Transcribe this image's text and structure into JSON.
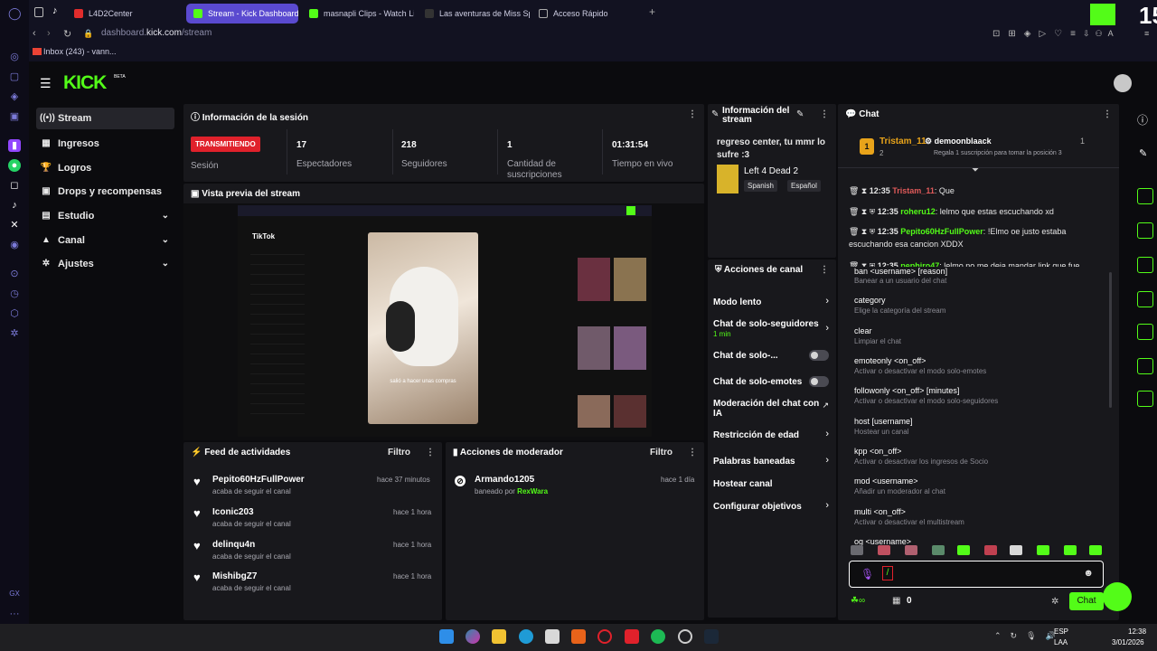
{
  "browser": {
    "tabs": [
      {
        "label": "L4D2Center",
        "color": "#e12c2c"
      },
      {
        "label": "Stream - Kick Dashboard",
        "color": "#53fc18"
      },
      {
        "label": "masnapli Clips - Watch Li",
        "color": "#53fc18"
      },
      {
        "label": "Las aventuras de Miss Sp",
        "color": "#ffffff"
      },
      {
        "label": "Acceso Rápido",
        "color": "#cfcfe4"
      }
    ],
    "url_prefix": "dashboard.",
    "url_domain": "kick.com",
    "url_path": "/stream",
    "bookmark": "Inbox (243) - vann...",
    "overlay_badge": "15"
  },
  "kick": {
    "logo": "KICK",
    "beta": "BETA"
  },
  "sidebar": {
    "items": [
      {
        "label": "Stream",
        "icon": "broadcast-icon"
      },
      {
        "label": "Ingresos",
        "icon": "chart-icon"
      },
      {
        "label": "Logros",
        "icon": "trophy-icon"
      },
      {
        "label": "Drops y recompensas",
        "icon": "gift-icon"
      },
      {
        "label": "Estudio",
        "icon": "layout-icon"
      },
      {
        "label": "Canal",
        "icon": "user-icon"
      },
      {
        "label": "Ajustes",
        "icon": "gear-icon"
      }
    ]
  },
  "session": {
    "title": "Información de la sesión",
    "live_badge": "TRANSMITIENDO",
    "session_label": "Sesión",
    "stats": [
      {
        "value": "17",
        "label": "Espectadores"
      },
      {
        "value": "218",
        "label": "Seguidores"
      },
      {
        "value": "1",
        "label": "Cantidad de suscripciones"
      },
      {
        "value": "01:31:54",
        "label": "Tiempo en vivo"
      }
    ]
  },
  "preview": {
    "title": "Vista previa del stream",
    "tiktok_label": "TikTok",
    "caption": "salió a hacer unas compras"
  },
  "stream_info": {
    "title": "Información del stream",
    "stream_title": "regreso center, tu mmr lo sufre :3",
    "game": "Left 4 Dead 2",
    "tags": [
      "Spanish",
      "Español"
    ]
  },
  "channel_actions": {
    "title": "Acciones de canal",
    "items": [
      {
        "label": "Modo lento",
        "type": "chevron"
      },
      {
        "label": "Chat de solo-seguidores",
        "sub": "1 min",
        "type": "chevron"
      },
      {
        "label": "Chat de solo-...",
        "type": "toggle"
      },
      {
        "label": "Chat de solo-emotes",
        "type": "toggle"
      },
      {
        "label": "Moderación del chat con IA",
        "type": "external"
      },
      {
        "label": "Restricción de edad",
        "type": "chevron"
      },
      {
        "label": "Palabras baneadas",
        "type": "chevron"
      },
      {
        "label": "Hostear canal",
        "type": "none"
      },
      {
        "label": "Configurar objetivos",
        "type": "chevron"
      }
    ]
  },
  "activity_feed": {
    "title": "Feed de actividades",
    "filter": "Filtro",
    "items": [
      {
        "name": "Pepito60HzFullPower",
        "action": "acaba de seguir el canal",
        "time": "hace 37 minutos"
      },
      {
        "name": "Iconic203",
        "action": "acaba de seguir el canal",
        "time": "hace 1 hora"
      },
      {
        "name": "delinqu4n",
        "action": "acaba de seguir el canal",
        "time": "hace 1 hora"
      },
      {
        "name": "MishibgZ7",
        "action": "acaba de seguir el canal",
        "time": "hace 1 hora"
      }
    ]
  },
  "mod_actions": {
    "title": "Acciones de moderador",
    "filter": "Filtro",
    "items": [
      {
        "name": "Armando1205",
        "action": "baneado por",
        "by": "RexWara",
        "time": "hace 1 día"
      }
    ]
  },
  "chat": {
    "title": "Chat",
    "top_gifter": {
      "rank": "1",
      "name": "Tristam_11",
      "count": "2"
    },
    "gift_goal": {
      "name": "demoonblaack",
      "count": "1",
      "text": "Regala 1 suscripción para tomar la posición 3"
    },
    "messages": [
      {
        "time": "12:35",
        "user": "Tristam_11",
        "user_color": "#e05a5a",
        "text": "Que"
      },
      {
        "time": "12:35",
        "user": "roheru12",
        "user_color": "#53fc18",
        "text": "lelmo que estas escuchando xd"
      },
      {
        "time": "12:35",
        "user": "Pepito60HzFullPower",
        "user_color": "#53fc18",
        "text": "!Elmo oe justo estaba escuchando esa cancion XDDX"
      },
      {
        "time": "12:35",
        "user": "pephiro47",
        "user_color": "#53fc18",
        "text": "lelmo no me deja mandar link que fue"
      }
    ],
    "commands": [
      {
        "name": "ban <username> [reason]",
        "desc": "Banear a un usuario del chat"
      },
      {
        "name": "category",
        "desc": "Elige la categoría del stream"
      },
      {
        "name": "clear",
        "desc": "Limpiar el chat"
      },
      {
        "name": "emoteonly <on_off>",
        "desc": "Activar o desactivar el modo solo-emotes"
      },
      {
        "name": "followonly <on_off> [minutes]",
        "desc": "Activar o desactivar el modo solo-seguidores"
      },
      {
        "name": "host [username]",
        "desc": "Hostear un canal"
      },
      {
        "name": "kpp <on_off>",
        "desc": "Activar o desactivar los ingresos de Socio"
      },
      {
        "name": "mod <username>",
        "desc": "Añadir un moderador al chat"
      },
      {
        "name": "multi <on_off>",
        "desc": "Activar o desactivar el multistream"
      },
      {
        "name": "og <username>",
        "desc": ""
      }
    ],
    "input_value": "/",
    "points": "0",
    "send_label": "Chat"
  },
  "taskbar": {
    "lang": "ESP",
    "lang_sub": "LAA",
    "time": "12:38",
    "date": "3/01/2026"
  },
  "colors": {
    "kick_green": "#53fc18",
    "live_red": "#e0212b",
    "panel": "#18181c",
    "opera_tab": "#5a4ad0"
  }
}
